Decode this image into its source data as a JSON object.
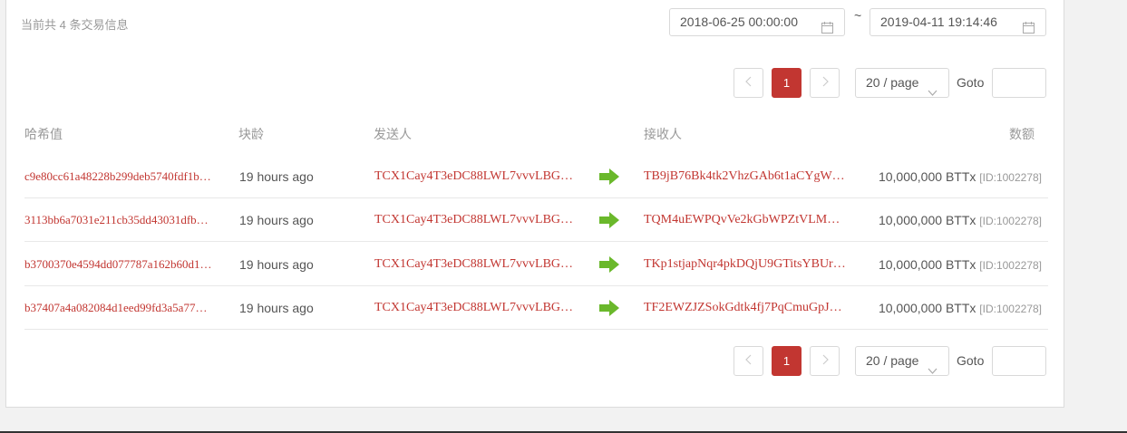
{
  "summary": "当前共 4 条交易信息",
  "date_range": {
    "start": "2018-06-25 00:00:00",
    "separator": "~",
    "end": "2019-04-11 19:14:46"
  },
  "pagination": {
    "current_page": "1",
    "page_size": "20 / page",
    "goto_label": "Goto",
    "goto_value": ""
  },
  "table": {
    "headers": {
      "hash": "哈希值",
      "age": "块龄",
      "from": "发送人",
      "to": "接收人",
      "amount": "数额"
    },
    "rows": [
      {
        "hash": "c9e80cc61a48228b299deb5740fdf1b…",
        "age": "19 hours ago",
        "from": "TCX1Cay4T3eDC88LWL7vvvLBG…",
        "to": "TB9jB76Bk4tk2VhzGAb6t1aCYgW…",
        "amount": "10,000,000",
        "token": "BTTx",
        "token_id": "[ID:1002278]"
      },
      {
        "hash": "3113bb6a7031e211cb35dd43031dfb…",
        "age": "19 hours ago",
        "from": "TCX1Cay4T3eDC88LWL7vvvLBG…",
        "to": "TQM4uEWPQvVe2kGbWPZtVLM…",
        "amount": "10,000,000",
        "token": "BTTx",
        "token_id": "[ID:1002278]"
      },
      {
        "hash": "b3700370e4594dd077787a162b60d1…",
        "age": "19 hours ago",
        "from": "TCX1Cay4T3eDC88LWL7vvvLBG…",
        "to": "TKp1stjapNqr4pkDQjU9GTitsYBUr…",
        "amount": "10,000,000",
        "token": "BTTx",
        "token_id": "[ID:1002278]"
      },
      {
        "hash": "b37407a4a082084d1eed99fd3a5a77…",
        "age": "19 hours ago",
        "from": "TCX1Cay4T3eDC88LWL7vvvLBG…",
        "to": "TF2EWZJZSokGdtk4fj7PqCmuGpJ…",
        "amount": "10,000,000",
        "token": "BTTx",
        "token_id": "[ID:1002278]"
      }
    ]
  },
  "colors": {
    "accent": "#c23631",
    "arrow_green": "#6ab82b",
    "muted_text": "#999999",
    "body_text": "#555555"
  },
  "icons": {
    "date": "calendar-icon",
    "prev": "chevron-left-icon",
    "next": "chevron-right-icon",
    "dropdown": "chevron-down-icon",
    "transfer": "arrow-right-icon"
  }
}
